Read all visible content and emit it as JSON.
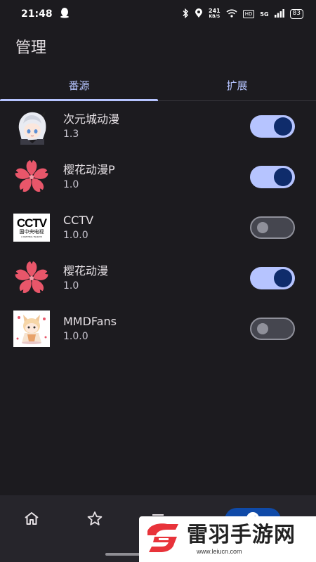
{
  "status_bar": {
    "time": "21:48",
    "net_speed_value": "241",
    "net_speed_unit": "KB/S",
    "hd": "HD",
    "signal": "5G",
    "battery": "83"
  },
  "app": {
    "title": "管理"
  },
  "tabs": [
    {
      "label": "番源",
      "active": true
    },
    {
      "label": "扩展",
      "active": false
    }
  ],
  "sources": [
    {
      "name": "次元城动漫",
      "version": "1.3",
      "enabled": true,
      "icon": "anime-girl-avatar-icon"
    },
    {
      "name": "樱花动漫P",
      "version": "1.0",
      "enabled": true,
      "icon": "sakura-flower-icon"
    },
    {
      "name": "CCTV",
      "version": "1.0.0",
      "enabled": false,
      "icon": "cctv-logo-icon",
      "logo_text": "CCTV",
      "logo_subtext": "国中央电视",
      "logo_small": "A CENTRAL TELEVIS"
    },
    {
      "name": "樱花动漫",
      "version": "1.0",
      "enabled": true,
      "icon": "sakura-flower-icon"
    },
    {
      "name": "MMDFans",
      "version": "1.0.0",
      "enabled": false,
      "icon": "chibi-character-icon"
    }
  ],
  "bottom_nav": [
    {
      "icon": "home-icon"
    },
    {
      "icon": "star-icon"
    },
    {
      "icon": "list-icon"
    },
    {
      "icon": "compass-icon",
      "active": true
    }
  ],
  "watermark": {
    "title": "雷羽手游网",
    "url": "www.leiucn.com"
  },
  "colors": {
    "background": "#1c1b1f",
    "accent": "#b6c4ff",
    "switch_knob_on": "#0f2c6b",
    "sakura": "#e8566a"
  }
}
